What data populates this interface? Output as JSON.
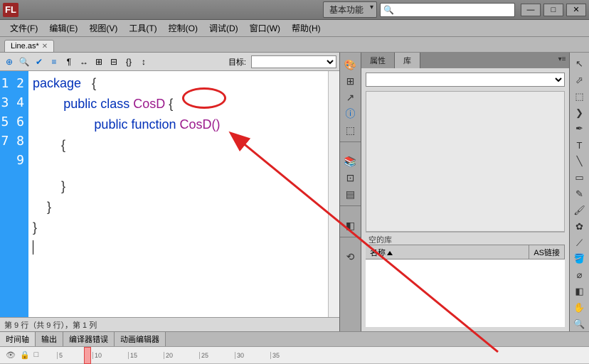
{
  "app": {
    "icon_label": "FL"
  },
  "titlebar": {
    "workspace": "基本功能",
    "search_placeholder": "🔍"
  },
  "menu": {
    "file": "文件(F)",
    "edit": "编辑(E)",
    "view": "视图(V)",
    "tools": "工具(T)",
    "control": "控制(O)",
    "debug": "调试(D)",
    "window": "窗口(W)",
    "help": "帮助(H)"
  },
  "file_tab": {
    "name": "Line.as*"
  },
  "editor_toolbar": {
    "target_label": "目标:"
  },
  "code": {
    "lines": [
      "1",
      "2",
      "3",
      "4",
      "5",
      "6",
      "7",
      "8",
      "9"
    ],
    "l1_kw": "package",
    "l1_rest": "   {",
    "l2_kw": "public class",
    "l2_cls": " CosD ",
    "l2_rest": "{",
    "l3_kw": "public function",
    "l3_fn": " CosD()",
    "l4": "        {",
    "l5": "",
    "l6": "        }",
    "l7": "    }",
    "l8": "}"
  },
  "statusbar": {
    "text": "第 9 行（共 9 行），第 1 列"
  },
  "bottom_tabs": {
    "timeline": "时间轴",
    "output": "输出",
    "errors": "编译器错误",
    "motion": "动画编辑器",
    "ticks": [
      "5",
      "10",
      "15",
      "20",
      "25",
      "30",
      "35"
    ]
  },
  "right": {
    "tab_props": "属性",
    "tab_lib": "库",
    "empty_label": "空的库",
    "col_name": "名称",
    "col_link": "AS链接"
  }
}
